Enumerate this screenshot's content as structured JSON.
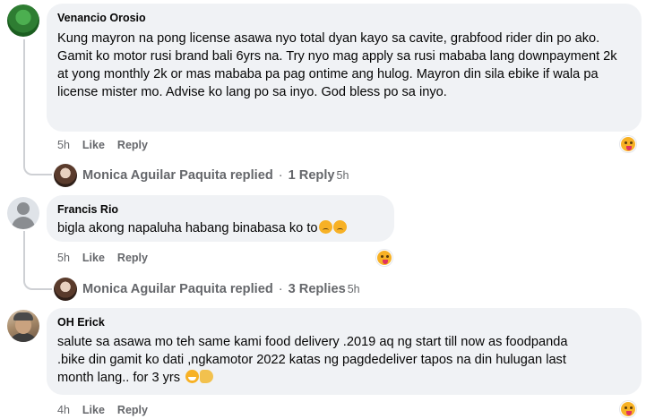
{
  "comments": [
    {
      "author": "Venancio Orosio",
      "text": "Kung mayron na pong license asawa nyo total dyan kayo sa cavite, grabfood rider din po ako. Gamit ko motor rusi brand bali 6yrs na. Try nyo mag apply sa rusi mababa lang downpayment 2k at yong monthly 2k or mas mababa pa pag ontime ang hulog. Mayron din sila ebike if wala pa license mister mo. Advise ko lang po sa inyo. God bless po sa inyo.",
      "time": "5h",
      "like": "Like",
      "reply": "Reply",
      "replies": {
        "name": "Monica Aguilar Paquita replied",
        "count": "1 Reply",
        "separator": "·",
        "time": "5h"
      }
    },
    {
      "author": "Francis Rio",
      "text": "bigla akong napaluha habang binabasa ko to",
      "time": "5h",
      "like": "Like",
      "reply": "Reply",
      "replies": {
        "name": "Monica Aguilar Paquita replied",
        "count": "3 Replies",
        "separator": "·",
        "time": "5h"
      }
    },
    {
      "author": "OH Erick",
      "text": "salute sa asawa mo teh same kami food delivery .2019 aq ng start till now as foodpanda .bike din gamit ko dati ,ngkamotor 2022 katas ng pagdedeliver tapos na din hulugan last month lang.. for 3 yrs",
      "time": "4h",
      "like": "Like",
      "reply": "Reply"
    }
  ],
  "icons": {
    "reaction": "care-reaction-icon",
    "avatar_default": "default-profile-icon"
  },
  "colors": {
    "bubble": "#f0f2f5",
    "meta": "#65676b",
    "text": "#050505"
  }
}
